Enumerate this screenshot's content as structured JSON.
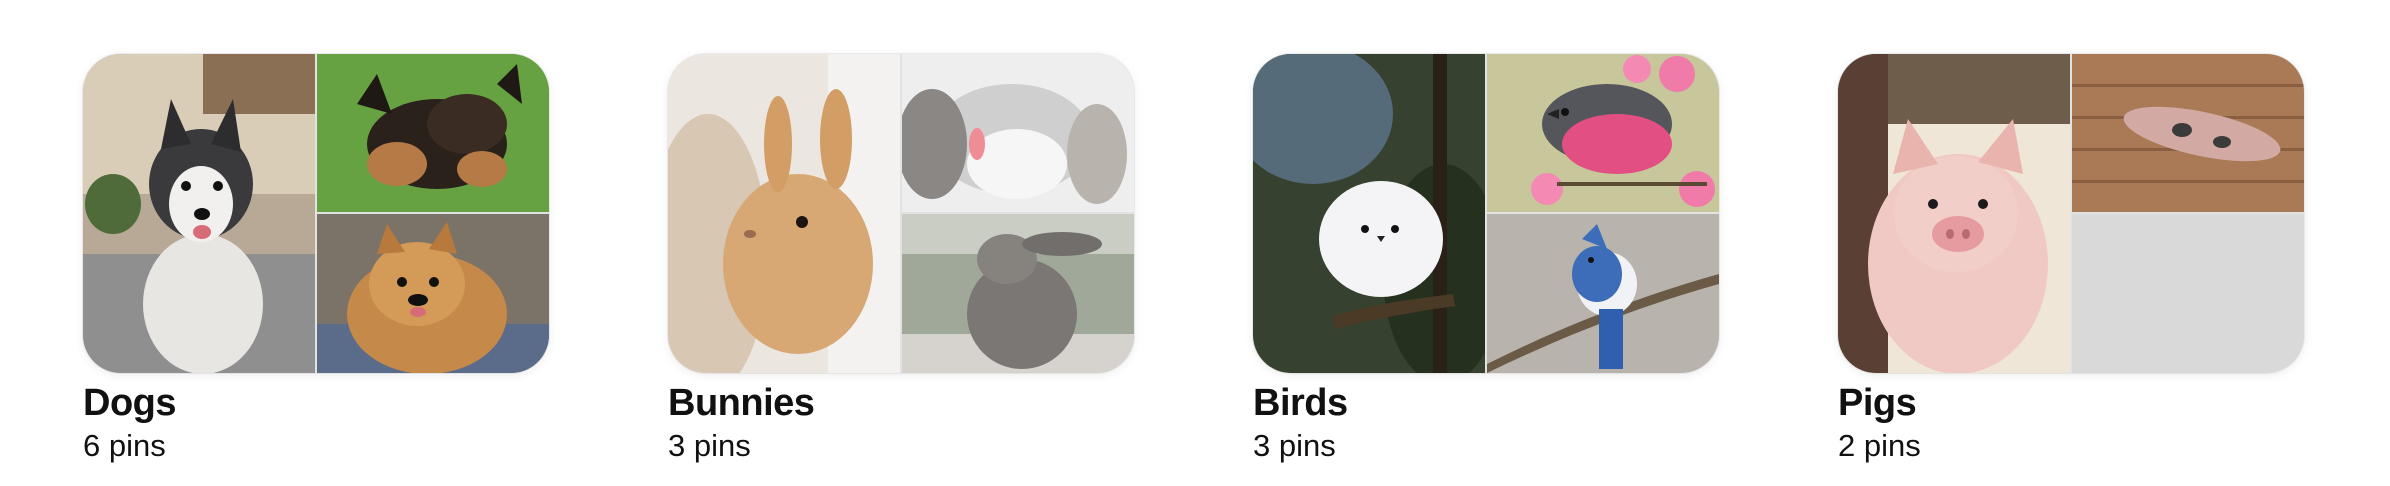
{
  "boards": [
    {
      "title": "Dogs",
      "count": "6 pins",
      "images": [
        "husky-puppy-photo",
        "german-shepherd-puppy-on-grass-photo",
        "pomeranian-photo"
      ]
    },
    {
      "title": "Bunnies",
      "count": "3 pins",
      "images": [
        "tan-bunny-photo",
        "lop-bunny-tongue-photo",
        "grey-bunny-standing-photo"
      ]
    },
    {
      "title": "Birds",
      "count": "3 pins",
      "images": [
        "white-fluffy-bird-photo",
        "pink-robin-on-flowers-photo",
        "blue-jay-on-branch-photo"
      ]
    },
    {
      "title": "Pigs",
      "count": "2 pins",
      "images": [
        "piglet-closeup-photo",
        "piglet-on-deck-photo"
      ]
    }
  ]
}
